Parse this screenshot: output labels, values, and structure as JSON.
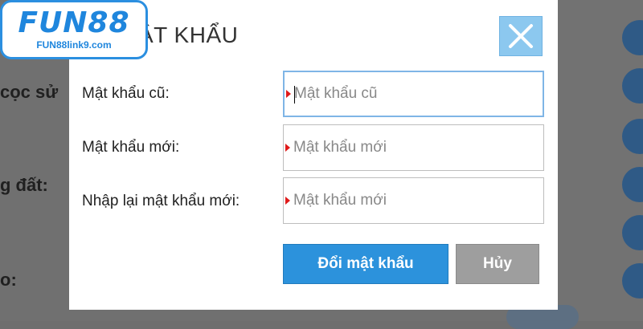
{
  "logo": {
    "main": "FUN88",
    "sub": "FUN88link9.com"
  },
  "background": {
    "labels": [
      "cọc sử",
      "g đất:",
      "o:"
    ]
  },
  "dialog": {
    "title": "ẬT KHẨU",
    "close_icon": "close-icon",
    "fields": [
      {
        "label": "Mật khẩu cũ:",
        "placeholder": "Mật khẩu cũ",
        "value": ""
      },
      {
        "label": "Mật khẩu mới:",
        "placeholder": "Mật khẩu mới",
        "value": ""
      },
      {
        "label": "Nhập lại mật khẩu mới:",
        "placeholder": "Mật khẩu mới",
        "value": ""
      }
    ],
    "submit_label": "Đổi mật khẩu",
    "cancel_label": "Hủy"
  },
  "colors": {
    "accent": "#2c92dc",
    "close_bg": "#8cc8ef",
    "cancel_bg": "#9e9e9e",
    "required_marker": "#e01a1a",
    "overlay": "#707070"
  }
}
